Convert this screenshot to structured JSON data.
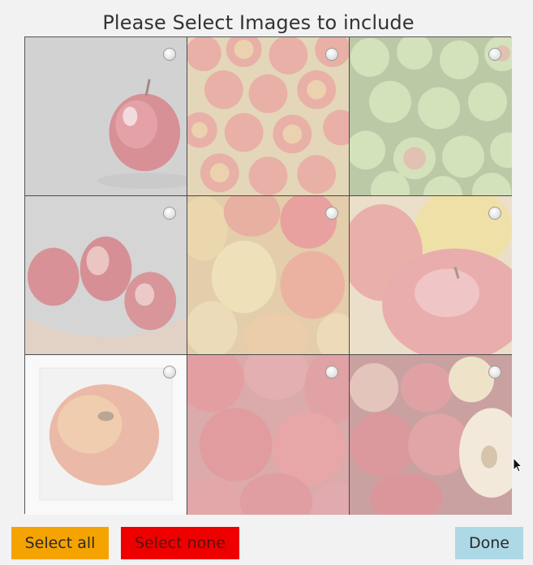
{
  "dialog": {
    "title": "Please Select Images to include"
  },
  "images": [
    {
      "subject": "single red apple on gray background",
      "selected": false
    },
    {
      "subject": "pile of red and yellow apples",
      "selected": false
    },
    {
      "subject": "pile of green apples",
      "selected": false
    },
    {
      "subject": "three red apples on dark background",
      "selected": false
    },
    {
      "subject": "close-up of yellow and red apples",
      "selected": false
    },
    {
      "subject": "wet red apple close-up",
      "selected": false
    },
    {
      "subject": "single apple on white background",
      "selected": false
    },
    {
      "subject": "red apples close-up",
      "selected": false
    },
    {
      "subject": "apples with sliced apple half",
      "selected": false
    }
  ],
  "buttons": {
    "select_all": "Select all",
    "select_none": "Select none",
    "done": "Done"
  },
  "colors": {
    "select_all_bg": "#f5a300",
    "select_none_bg": "#ee0000",
    "done_bg": "#add8e6",
    "background": "#f2f2f2"
  },
  "icons": {
    "cursor": "mouse-pointer-icon",
    "radio": "radio-button-icon"
  }
}
